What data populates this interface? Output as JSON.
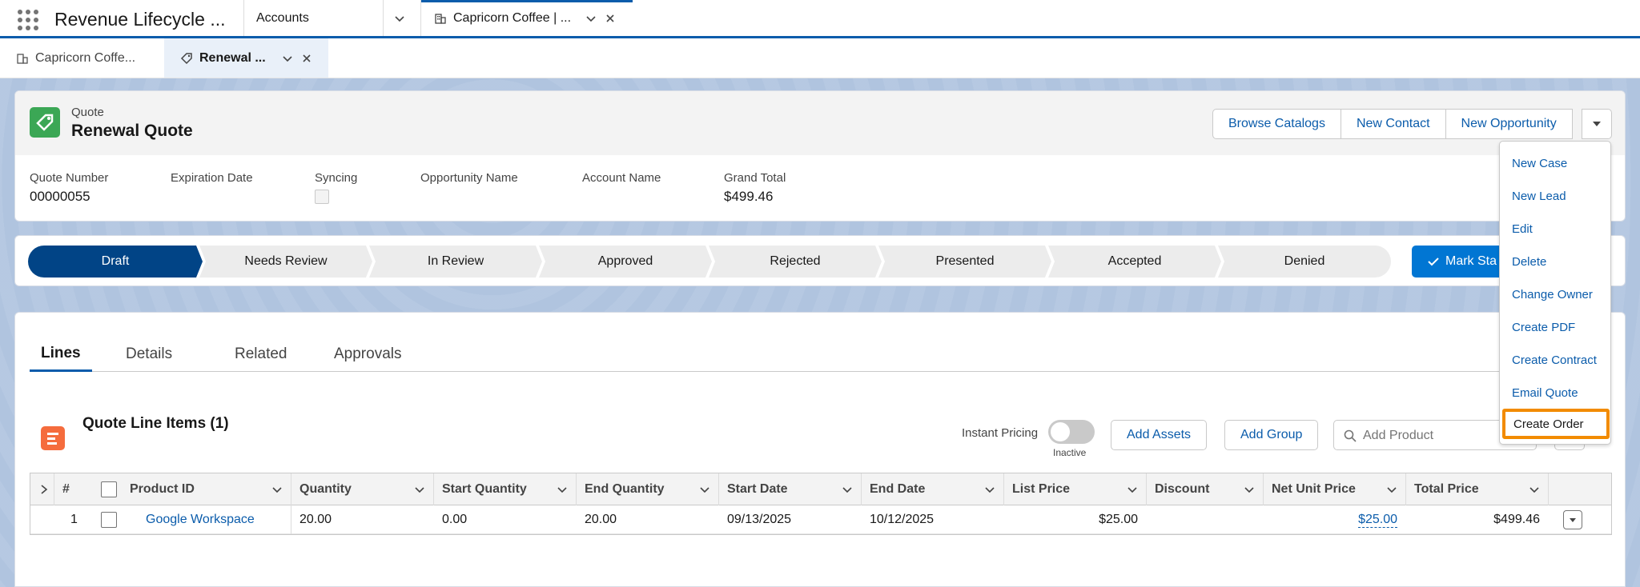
{
  "app": {
    "name": "Revenue Lifecycle ...",
    "nav_item": "Accounts"
  },
  "workspace_tab": {
    "label": "Capricorn Coffee | ..."
  },
  "subtabs": [
    {
      "label": "Capricorn Coffe..."
    },
    {
      "label": "Renewal ..."
    }
  ],
  "record": {
    "object_label": "Quote",
    "title": "Renewal Quote",
    "actions": [
      "Browse Catalogs",
      "New Contact",
      "New Opportunity"
    ],
    "fields": [
      {
        "label": "Quote Number",
        "value": "00000055"
      },
      {
        "label": "Expiration Date",
        "value": ""
      },
      {
        "label": "Syncing",
        "value": ""
      },
      {
        "label": "Opportunity Name",
        "value": ""
      },
      {
        "label": "Account Name",
        "value": ""
      },
      {
        "label": "Grand Total",
        "value": "$499.46"
      }
    ]
  },
  "path": {
    "stages": [
      "Draft",
      "Needs Review",
      "In Review",
      "Approved",
      "Rejected",
      "Presented",
      "Accepted",
      "Denied"
    ],
    "current": "Draft",
    "mark_button": "Mark Sta"
  },
  "tabs": [
    "Lines",
    "Details",
    "Related",
    "Approvals"
  ],
  "related_list": {
    "title": "Quote Line Items (1)",
    "instant_pricing_label": "Instant Pricing",
    "instant_pricing_state": "Inactive",
    "add_assets": "Add Assets",
    "add_group": "Add Group",
    "search_placeholder": "Add Product"
  },
  "table": {
    "columns": [
      "#",
      "Product ID",
      "Quantity",
      "Start Quantity",
      "End Quantity",
      "Start Date",
      "End Date",
      "List Price",
      "Discount",
      "Net Unit Price",
      "Total Price"
    ],
    "rows": [
      {
        "num": "1",
        "product": "Google Workspace",
        "quantity": "20.00",
        "start_quantity": "0.00",
        "end_quantity": "20.00",
        "start_date": "09/13/2025",
        "end_date": "10/12/2025",
        "list_price": "$25.00",
        "discount": "",
        "net_unit_price": "$25.00",
        "total_price": "$499.46"
      }
    ]
  },
  "dropdown": {
    "items": [
      "New Case",
      "New Lead",
      "Edit",
      "Delete",
      "Change Owner",
      "Create PDF",
      "Create Contract",
      "Email Quote",
      "Create Order"
    ],
    "highlighted": "Create Order"
  },
  "colors": {
    "brand": "#0b5cab",
    "path_current": "#014486",
    "quote_icon": "#3ba755",
    "related_icon": "#f56c3d",
    "highlight": "#f28b00"
  }
}
